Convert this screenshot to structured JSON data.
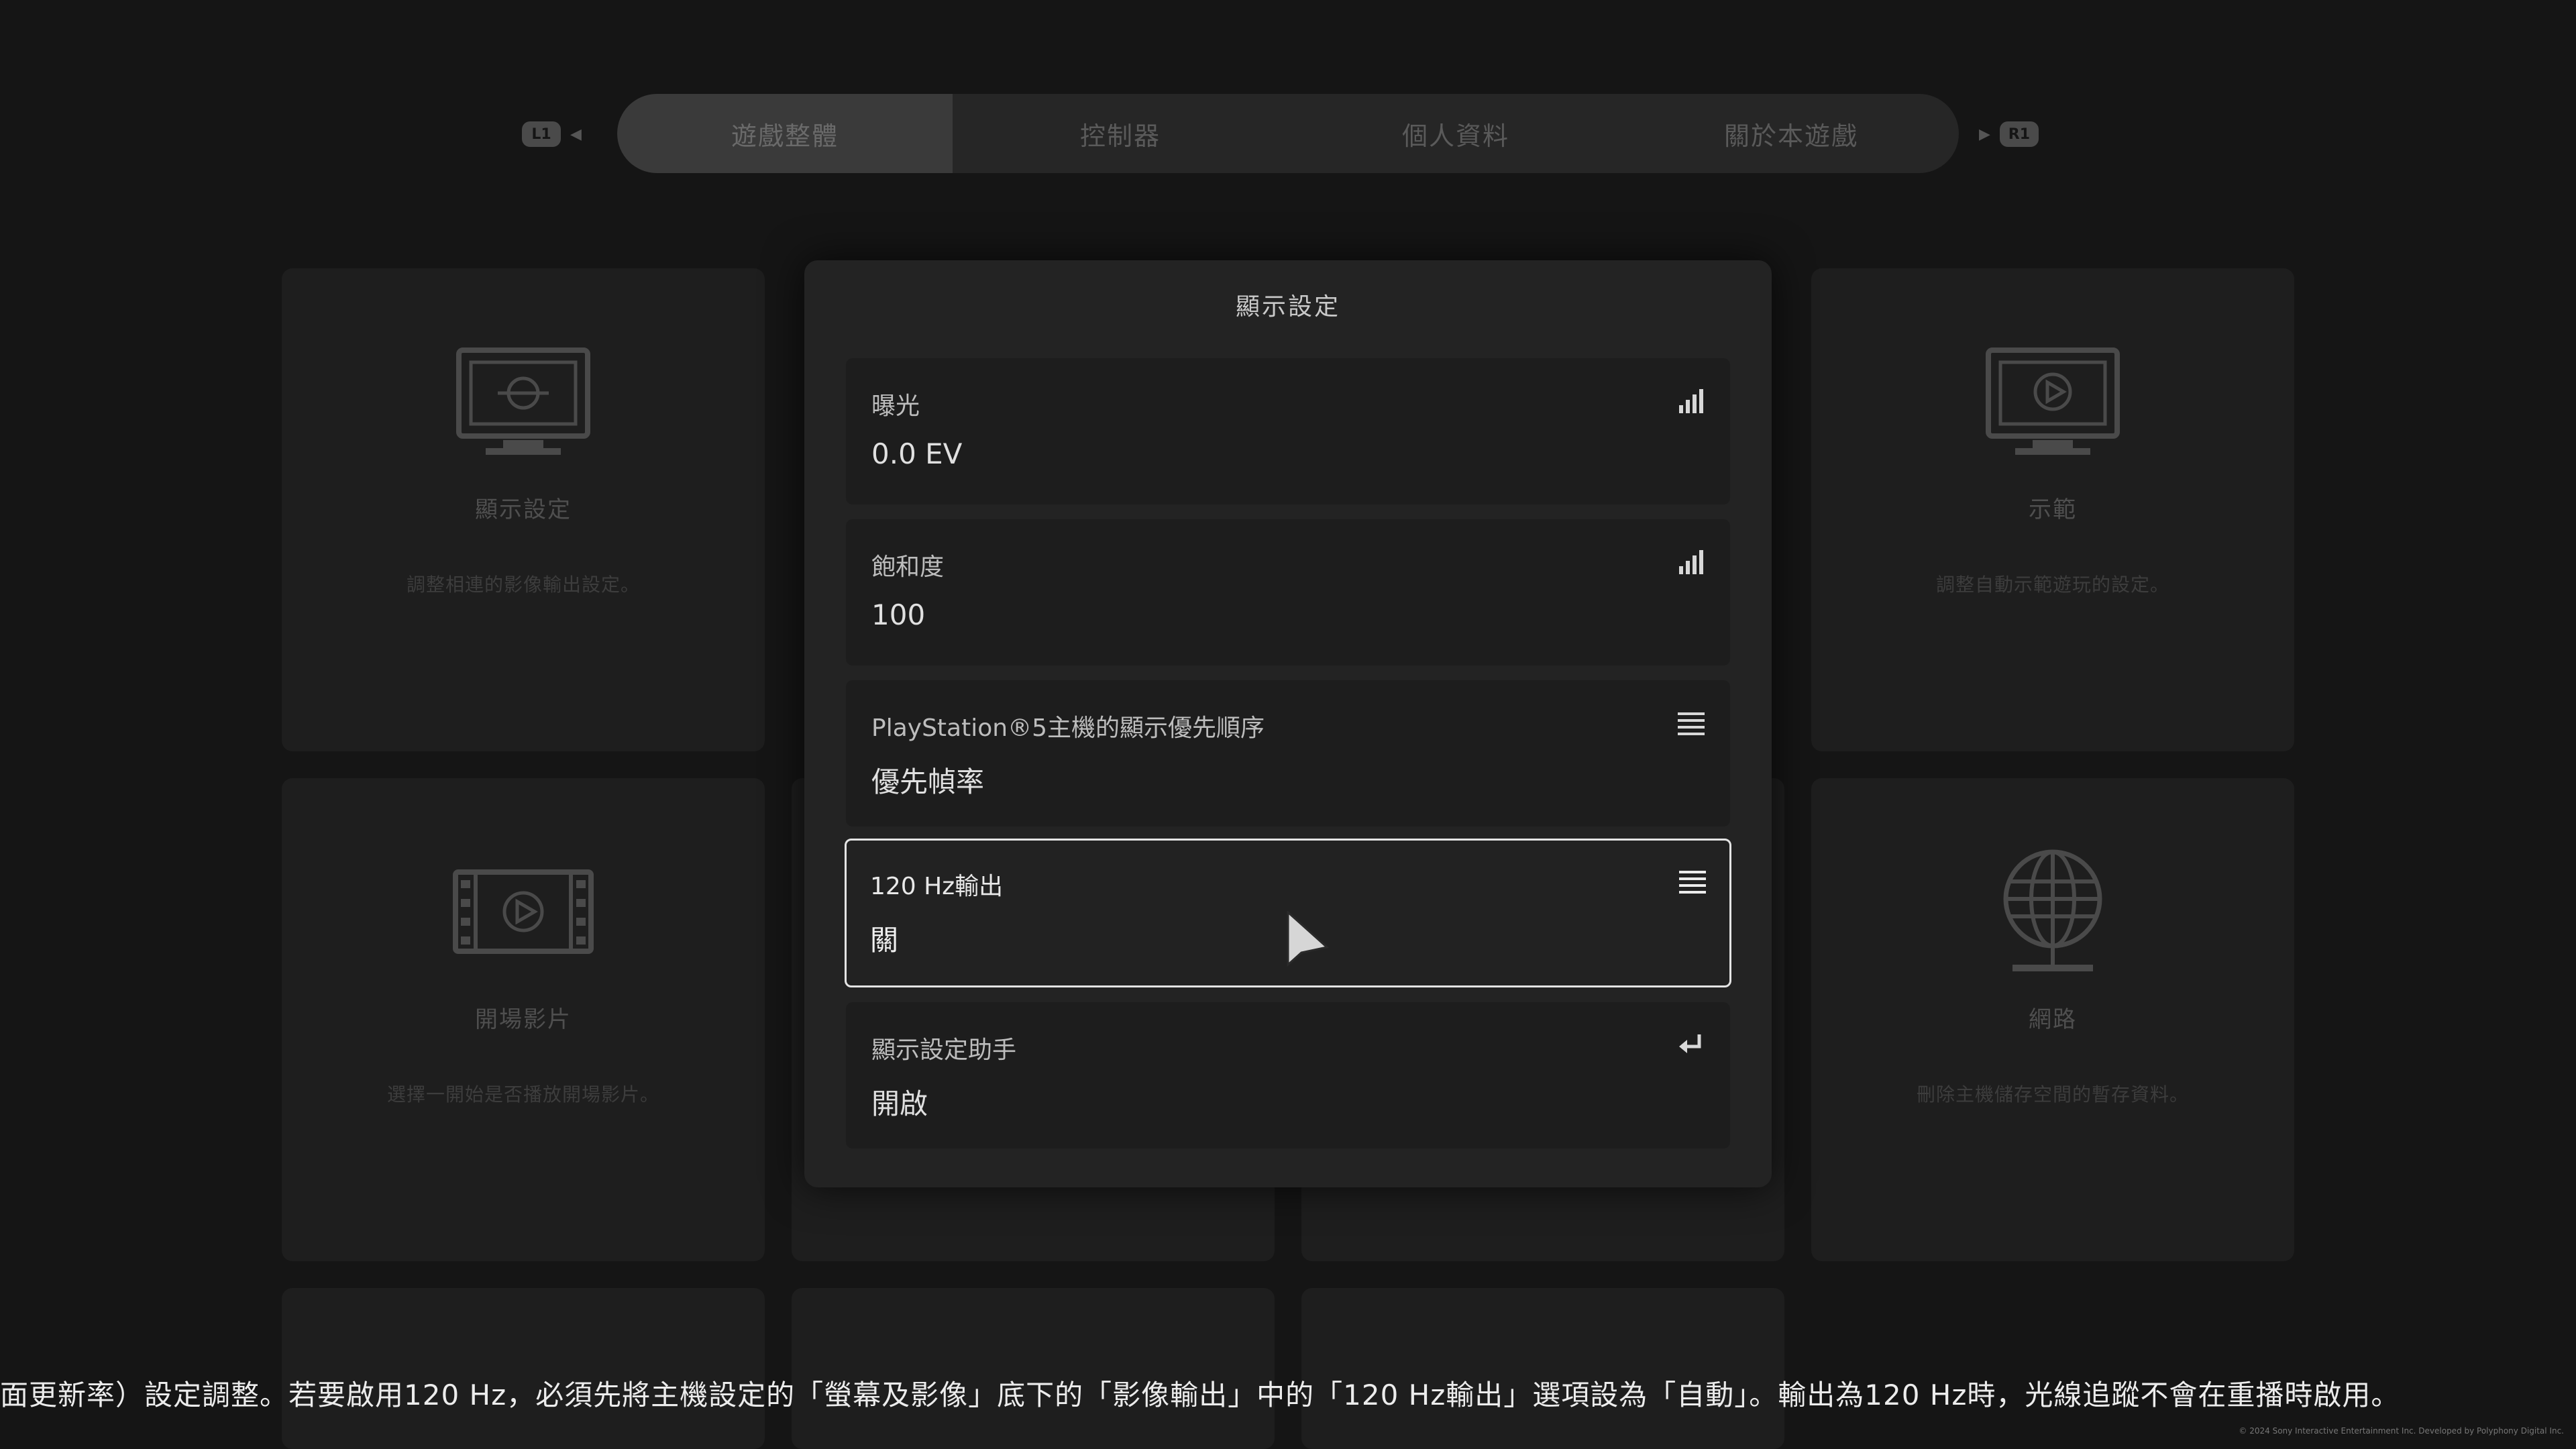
{
  "nav": {
    "left_button": "L1",
    "right_button": "R1",
    "tabs": [
      {
        "label": "遊戲整體",
        "active": true
      },
      {
        "label": "控制器",
        "active": false
      },
      {
        "label": "個人資料",
        "active": false
      },
      {
        "label": "關於本遊戲",
        "active": false
      }
    ]
  },
  "background_cards": [
    {
      "title": "顯示設定",
      "desc": "調整相連的影像輸出設定。",
      "icon": "monitor-icon"
    },
    {
      "title": "示範",
      "desc": "調整自動示範遊玩的設定。",
      "icon": "monitor-play-icon"
    },
    {
      "title": "開場影片",
      "desc": "選擇一開始是否播放開場影片。",
      "icon": "film-icon"
    },
    {
      "title": "網路",
      "desc": "刪除主機儲存空間的暫存資料。",
      "icon": "globe-icon"
    }
  ],
  "modal": {
    "title": "顯示設定",
    "rows": [
      {
        "label": "曝光",
        "value": "0.0 EV",
        "icon": "slider-bars-icon"
      },
      {
        "label": "飽和度",
        "value": "100",
        "icon": "slider-bars-icon"
      },
      {
        "label": "PlayStation®5主機的顯示優先順序",
        "value": "優先幀率",
        "icon": "list-icon"
      },
      {
        "label": "120 Hz輸出",
        "value": "關",
        "icon": "list-icon",
        "focused": true
      },
      {
        "label": "顯示設定助手",
        "value": "開啟",
        "icon": "enter-icon"
      }
    ]
  },
  "caption": "面更新率）設定調整。若要啟用120 Hz，必須先將主機設定的「螢幕及影像」底下的「影像輸出」中的「120 Hz輸出」選項設為「自動」。輸出為120 Hz時，光線追蹤不會在重播時啟用。",
  "copyright": "© 2024 Sony Interactive Entertainment Inc. Developed by Polyphony Digital Inc."
}
